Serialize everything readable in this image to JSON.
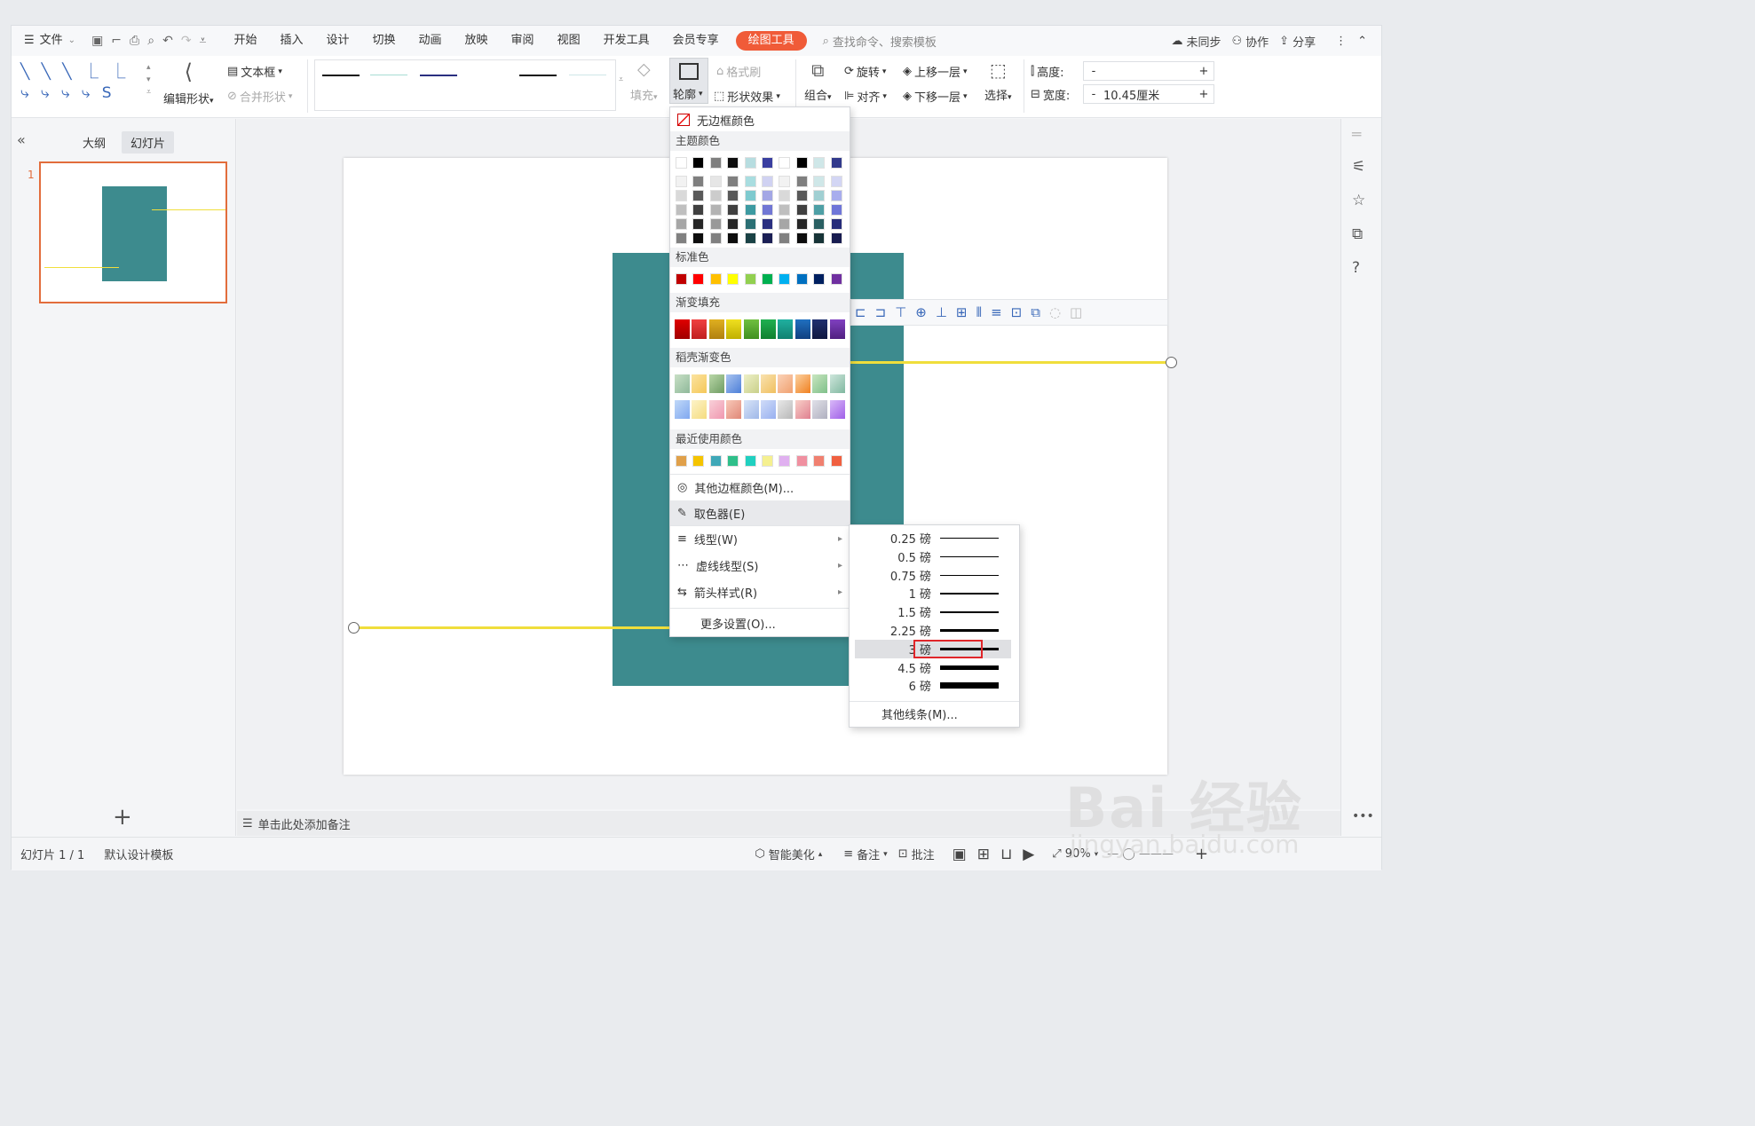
{
  "menu": {
    "file": "文件",
    "tabs": [
      "开始",
      "插入",
      "设计",
      "切换",
      "动画",
      "放映",
      "审阅",
      "视图",
      "开发工具",
      "会员专享"
    ],
    "active_tab": "绘图工具",
    "search_placeholder": "查找命令、搜索模板",
    "sync": "未同步",
    "collab": "协作",
    "share": "分享"
  },
  "ribbon": {
    "edit_shape": "编辑形状",
    "textbox": "文本框",
    "merge_shape": "合并形状",
    "fill": "填充",
    "format_brush": "格式刷",
    "outline": "轮廓",
    "shape_effect": "形状效果",
    "group": "组合",
    "rotate": "旋转",
    "align": "对齐",
    "bring_forward": "上移一层",
    "send_backward": "下移一层",
    "select": "选择",
    "height_label": "高度:",
    "width_label": "宽度:",
    "height_value": "",
    "width_value": "10.45厘米",
    "minus": "-",
    "plus": "+"
  },
  "left_panel": {
    "outline_tab": "大纲",
    "slides_tab": "幻灯片",
    "slide_number": "1",
    "add": "+"
  },
  "notes": "单击此处添加备注",
  "status": {
    "slide_info": "幻灯片 1 / 1",
    "template": "默认设计模板",
    "beautify": "智能美化",
    "notes": "备注",
    "comments": "批注",
    "zoom": "90%"
  },
  "dropdown": {
    "no_border": "无边框颜色",
    "theme_colors": "主题颜色",
    "standard_colors": "标准色",
    "gradient_fill": "渐变填充",
    "daoke_gradient": "稻壳渐变色",
    "recent_colors": "最近使用颜色",
    "more_colors": "其他边框颜色(M)...",
    "eyedropper": "取色器(E)",
    "line_type": "线型(W)",
    "dash_type": "虚线线型(S)",
    "arrow_style": "箭头样式(R)",
    "more_settings": "更多设置(O)...",
    "theme_top": [
      "#ffffff",
      "#000000",
      "#7f7f7f",
      "#0d0d0d",
      "#b7dde0",
      "#3a3fa0",
      "#ffffff",
      "#000000",
      "#cfe7e8",
      "#323a8c"
    ],
    "theme_cols": [
      [
        "#f2f2f2",
        "#d9d9d9",
        "#bfbfbf",
        "#a6a6a6",
        "#808080"
      ],
      [
        "#7f7f7f",
        "#595959",
        "#404040",
        "#262626",
        "#0d0d0d"
      ],
      [
        "#e6e6e6",
        "#cccccc",
        "#b3b3b3",
        "#999999",
        "#808080"
      ],
      [
        "#7f7f7f",
        "#595959",
        "#404040",
        "#262626",
        "#0d0d0d"
      ],
      [
        "#a9dde0",
        "#7ecacf",
        "#3d9aa1",
        "#2b6f74",
        "#1a4245"
      ],
      [
        "#d0d2f2",
        "#a3a7e5",
        "#7177d4",
        "#2a2f80",
        "#1b1f55"
      ],
      [
        "#f2f2f2",
        "#d9d9d9",
        "#bfbfbf",
        "#a6a6a6",
        "#808080"
      ],
      [
        "#7f7f7f",
        "#595959",
        "#404040",
        "#262626",
        "#0d0d0d"
      ],
      [
        "#cfe7e8",
        "#a0cfd2",
        "#4e9fa5",
        "#2a5f62",
        "#173437"
      ],
      [
        "#d3d6f4",
        "#a8aded",
        "#6f76d8",
        "#262c7a",
        "#181c50"
      ]
    ],
    "standard": [
      "#c00000",
      "#ff0000",
      "#ffc000",
      "#ffff00",
      "#92d050",
      "#00b050",
      "#00b0f0",
      "#0070c0",
      "#002060",
      "#7030a0"
    ],
    "gradients": [
      [
        "#e00000",
        "#a00000"
      ],
      [
        "#f04040",
        "#c02020"
      ],
      [
        "#e0b020",
        "#b08010"
      ],
      [
        "#f0e020",
        "#c0b000"
      ],
      [
        "#70c040",
        "#409020"
      ],
      [
        "#20b050",
        "#108030"
      ],
      [
        "#20b0a0",
        "#108070"
      ],
      [
        "#2070c0",
        "#104080"
      ],
      [
        "#203070",
        "#101840"
      ],
      [
        "#8040c0",
        "#502080"
      ]
    ],
    "daoke_row1": [
      [
        "#c9e0c6",
        "#8fb99a"
      ],
      [
        "#fbe3a0",
        "#f5c85a"
      ],
      [
        "#b9d7a8",
        "#6f9c63"
      ],
      [
        "#a9c4f0",
        "#4d7fd8"
      ],
      [
        "#eef0c8",
        "#c9d08a"
      ],
      [
        "#f9e2b0",
        "#f0c060"
      ],
      [
        "#fbd3b8",
        "#f0a070"
      ],
      [
        "#fcd1a0",
        "#f08020"
      ],
      [
        "#c9e6c0",
        "#7fc08a"
      ],
      [
        "#cfe6dc",
        "#80b8a0"
      ]
    ],
    "daoke_row2": [
      [
        "#c0d8f8",
        "#80a8f0"
      ],
      [
        "#fdf3c8",
        "#f5dc80"
      ],
      [
        "#f8d0d8",
        "#f098b0"
      ],
      [
        "#f8c8b8",
        "#e08878"
      ],
      [
        "#d8e4f8",
        "#a0b8e8"
      ],
      [
        "#d0dcf8",
        "#98b0f0"
      ],
      [
        "#e8e8e8",
        "#b8b8b8"
      ],
      [
        "#f8d0c8",
        "#e08090"
      ],
      [
        "#e0e0e8",
        "#b0b0c0"
      ],
      [
        "#d8b8f8",
        "#a060e8"
      ]
    ],
    "recent": [
      "#e0a04a",
      "#f5c400",
      "#3fa8b8",
      "#2fbf8a",
      "#20d0c0",
      "#f5f090",
      "#e0b0f0",
      "#f090a0",
      "#f08070",
      "#f06040"
    ]
  },
  "line_weights": [
    {
      "label": "0.25 磅",
      "weight": 0.5
    },
    {
      "label": "0.5 磅",
      "weight": 1
    },
    {
      "label": "0.75 磅",
      "weight": 1.2
    },
    {
      "label": "1 磅",
      "weight": 1.5
    },
    {
      "label": "1.5 磅",
      "weight": 2
    },
    {
      "label": "2.25 磅",
      "weight": 2.5
    },
    {
      "label": "3 磅",
      "weight": 3.5,
      "selected": true
    },
    {
      "label": "4.5 磅",
      "weight": 5
    },
    {
      "label": "6 磅",
      "weight": 7
    }
  ],
  "other_lines": "其他线条(M)...",
  "colors": {
    "accent": "#f05b38",
    "teal": "#3d8b8e",
    "line_yellow": "#f0de3c",
    "selection_red": "#e0262a"
  },
  "watermark": {
    "main": "Bai 经验",
    "sub": "jingyan.baidu.com"
  }
}
